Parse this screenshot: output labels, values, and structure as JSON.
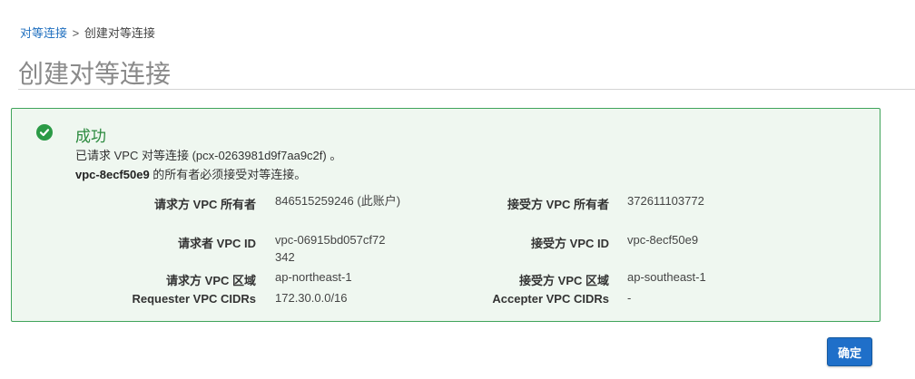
{
  "breadcrumb": {
    "root_link": "对等连接",
    "separator": ">",
    "current": "创建对等连接"
  },
  "page_title": "创建对等连接",
  "panel": {
    "title": "成功",
    "message_line1": "已请求 VPC 对等连接 (pcx-0263981d9f7aa9c2f) 。",
    "message_vpc": "vpc-8ecf50e9",
    "message_line2_rest": " 的所有者必须接受对等连接。",
    "details": {
      "requester_owner_label": "请求方 VPC 所有者",
      "requester_owner_value": "846515259246 (此账户)",
      "requester_vpc_id_label": "请求者 VPC ID",
      "requester_vpc_id_value": "vpc-06915bd057cf72342",
      "requester_region_label": "请求方 VPC 区域",
      "requester_region_value": "ap-northeast-1",
      "requester_cidrs_label": "Requester VPC CIDRs",
      "requester_cidrs_value": "172.30.0.0/16",
      "accepter_owner_label": "接受方 VPC 所有者",
      "accepter_owner_value": "372611103772",
      "accepter_vpc_id_label": "接受方 VPC ID",
      "accepter_vpc_id_value": "vpc-8ecf50e9",
      "accepter_region_label": "接受方 VPC 区域",
      "accepter_region_value": "ap-southeast-1",
      "accepter_cidrs_label": "Accepter VPC CIDRs",
      "accepter_cidrs_value": "-"
    }
  },
  "ok_button": "确定",
  "colors": {
    "success": "#2b9a46",
    "panel_bg": "#eff7f0",
    "link": "#1f6fbf",
    "primary_button": "#1f6fc9"
  },
  "icons": {
    "success": "check-circle-icon"
  }
}
